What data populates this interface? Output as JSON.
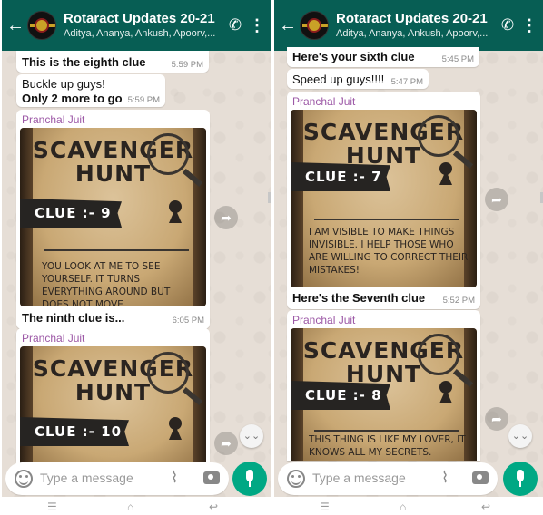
{
  "left": {
    "header": {
      "title": "Rotaract Updates 20-21",
      "subtitle": "Aditya, Ananya, Ankush, Apoorv,...",
      "back_icon": "arrow-left-icon",
      "call_icon": "add-call-icon",
      "menu_icon": "more-vert-icon"
    },
    "messages": {
      "m1": {
        "text": "This is the eighth clue",
        "time": "5:59 PM"
      },
      "m2": {
        "line1": "Buckle up guys!",
        "line2": "Only 2 more to go",
        "time": "5:59 PM"
      },
      "m3": {
        "sender": "Pranchal Juit",
        "poster_title1": "SCAVENGER",
        "poster_title2": "HUNT",
        "clue": "CLUE :- 9",
        "riddle": "YOU LOOK AT ME TO SEE YOURSELF. IT TURNS EVERYTHING AROUND BUT DOES NOT MOVE.",
        "caption": "The ninth clue is...",
        "time": "6:05 PM"
      },
      "m4": {
        "sender": "Pranchal Juit",
        "poster_title1": "SCAVENGER",
        "poster_title2": "HUNT",
        "clue": "CLUE :- 10"
      }
    },
    "input": {
      "placeholder": "Type a message"
    }
  },
  "right": {
    "header": {
      "title": "Rotaract Updates 20-21",
      "subtitle": "Aditya, Ananya, Ankush, Apoorv,..."
    },
    "messages": {
      "m1": {
        "text": "Here's your sixth clue",
        "time": "5:45 PM"
      },
      "m2": {
        "text": "Speed up guys!!!!",
        "time": "5:47 PM"
      },
      "m3": {
        "sender": "Pranchal Juit",
        "poster_title1": "SCAVENGER",
        "poster_title2": "HUNT",
        "clue": "CLUE :- 7",
        "riddle": "I AM VISIBLE TO MAKE THINGS INVISIBLE. I HELP THOSE WHO ARE WILLING TO CORRECT THEIR MISTAKES!",
        "caption": "Here's the Seventh clue",
        "time": "5:52 PM"
      },
      "m4": {
        "sender": "Pranchal Juit",
        "poster_title1": "SCAVENGER",
        "poster_title2": "HUNT",
        "clue": "CLUE :- 8",
        "riddle": "THIS THING IS LIKE MY LOVER, IT KNOWS ALL MY SECRETS."
      }
    },
    "input": {
      "placeholder": "Type a message"
    }
  },
  "colors": {
    "header": "#075e54",
    "accent": "#00a884",
    "sender": "#9c58a6",
    "chat_bg": "#e5ddd5"
  }
}
